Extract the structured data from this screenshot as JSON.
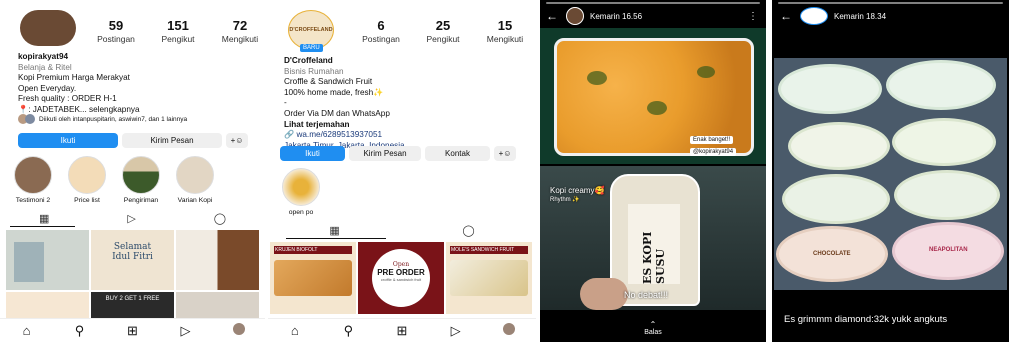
{
  "profile1": {
    "username": "kopirakyat94",
    "stats": [
      {
        "num": "59",
        "label": "Postingan"
      },
      {
        "num": "151",
        "label": "Pengikut"
      },
      {
        "num": "72",
        "label": "Mengikuti"
      }
    ],
    "category": "Belanja & Ritel",
    "bio_lines": [
      "Kopi Premium Harga Merakyat",
      "Open Everyday.",
      "Fresh quality : ORDER H-1"
    ],
    "location_line": "📍: JADETABEK... selengkapnya",
    "followed_by": "Diikuti oleh intanpuspitarin, aswiwin7, dan 1 lainnya",
    "buttons": {
      "follow": "Ikuti",
      "message": "Kirim Pesan"
    },
    "highlights": [
      "Testimoni 2",
      "Price list",
      "Pengiriman",
      "Varian Kopi"
    ],
    "posts": [
      "",
      "Selamat Idul Fitri",
      "",
      "",
      "BUY 2 GET 1 FREE",
      ""
    ]
  },
  "profile2": {
    "logo_text": "D'CROFFELAND",
    "badge": "BARU",
    "name": "D'Croffeland",
    "stats": [
      {
        "num": "6",
        "label": "Postingan"
      },
      {
        "num": "25",
        "label": "Pengikut"
      },
      {
        "num": "15",
        "label": "Mengikuti"
      }
    ],
    "category": "Bisnis Rumahan",
    "bio_lines": [
      "Croffle & Sandwich Fruit",
      "100% home made, fresh✨",
      "-",
      "Order Via DM dan WhatsApp"
    ],
    "translate": "Lihat terjemahan",
    "link": "🔗 wa.me/6289513937051",
    "address": "Jakarta Timur, Jakarta, Indonesia",
    "buttons": {
      "follow": "Ikuti",
      "message": "Kirim Pesan",
      "contact": "Kontak"
    },
    "highlight": "open po",
    "posts": [
      {
        "title": "KRUJEN BIOFOLT"
      },
      {
        "title": "PRE ORDER",
        "top": "Open",
        "sub": "croffle & sandwich fruit"
      },
      {
        "title": "MOLE'S SANDWICH FRUIT"
      }
    ]
  },
  "story1": {
    "time": "Kemarin 16.56",
    "sticker1": "Enak banget!!",
    "sticker2": "@kopirakyat94",
    "caption_top": "Kopi creamy🥰",
    "caption_top2": "Rhythm ✨",
    "bottle_text": "ES KOPI SUSU",
    "caption": "No debat!!!",
    "reply": "Balas"
  },
  "story2": {
    "time": "Kemarin 18.34",
    "caption": "Es grimmm diamond:32k yukk angkuts",
    "tubs": [
      "",
      "",
      "",
      "",
      "",
      "",
      "CHOCOLATE",
      "NEAPOLITAN"
    ]
  },
  "colors": {
    "accent": "#1f8ef1",
    "brand_mustard": "#e8b23a",
    "croffle_red": "#7a1318"
  }
}
